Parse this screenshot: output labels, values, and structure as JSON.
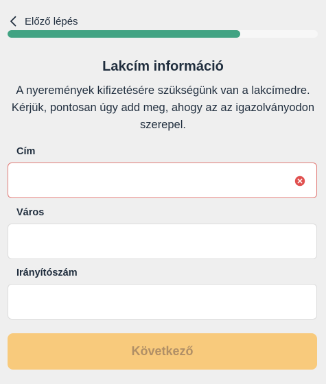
{
  "header": {
    "back_label": "Előző lépés",
    "progress_fraction": 0.75
  },
  "main": {
    "title": "Lakcím információ",
    "subtitle": "A nyeremények kifizetésére szükségünk van a lakcímedre. Kérjük, pontosan úgy add meg, ahogy az az igazolványodon szerepel."
  },
  "form": {
    "address": {
      "label": "Cím",
      "value": ""
    },
    "city": {
      "label": "Város",
      "value": ""
    },
    "zip": {
      "label": "Irányítószám",
      "value": ""
    }
  },
  "footer": {
    "next_label": "Következő"
  },
  "colors": {
    "progress": "#41a383",
    "error": "#e07a76",
    "button": "#f8ca7c"
  },
  "icons": {
    "back": "chevron-left-icon",
    "clear": "clear-circle-x-icon"
  }
}
